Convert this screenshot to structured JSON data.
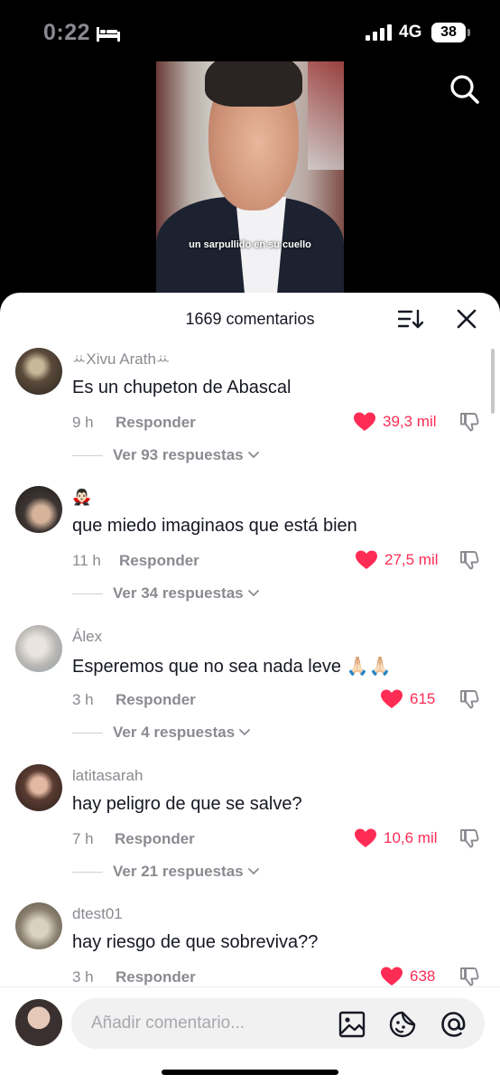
{
  "status_bar": {
    "time": "0:22",
    "network": "4G",
    "battery": "38"
  },
  "video": {
    "caption": "un sarpullido en su cuello"
  },
  "sheet": {
    "title": "1669 comentarios"
  },
  "comments": [
    {
      "user": "ꕁXivu Arathꕁ",
      "text": "Es un chupeton de Abascal",
      "time": "9 h",
      "reply": "Responder",
      "likes": "39,3 mil",
      "replies": "Ver 93 respuestas"
    },
    {
      "user": "🧛🏻‍♂️",
      "text": "que miedo imaginaos que está bien",
      "time": "11 h",
      "reply": "Responder",
      "likes": "27,5 mil",
      "replies": "Ver 34 respuestas"
    },
    {
      "user": "Álex",
      "text": "Esperemos que no sea nada leve 🙏🏻🙏🏻",
      "time": "3 h",
      "reply": "Responder",
      "likes": "615",
      "replies": "Ver 4 respuestas"
    },
    {
      "user": "latitasarah",
      "text": "hay peligro de que se salve?",
      "time": "7 h",
      "reply": "Responder",
      "likes": "10,6 mil",
      "replies": "Ver 21 respuestas"
    },
    {
      "user": "dtest01",
      "text": "hay riesgo de que sobreviva??",
      "time": "3 h",
      "reply": "Responder",
      "likes": "638",
      "replies": ""
    }
  ],
  "composer": {
    "placeholder": "Añadir comentario..."
  },
  "colors": {
    "accent": "#fe2c55",
    "secondary_text": "#8a8b91",
    "primary_text": "#161823"
  },
  "icons": [
    "bed-icon",
    "signal-icon",
    "search-icon",
    "sort-icon",
    "close-icon",
    "heart-icon",
    "dislike-icon",
    "chevron-down-icon",
    "image-icon",
    "sticker-icon",
    "mention-icon"
  ]
}
